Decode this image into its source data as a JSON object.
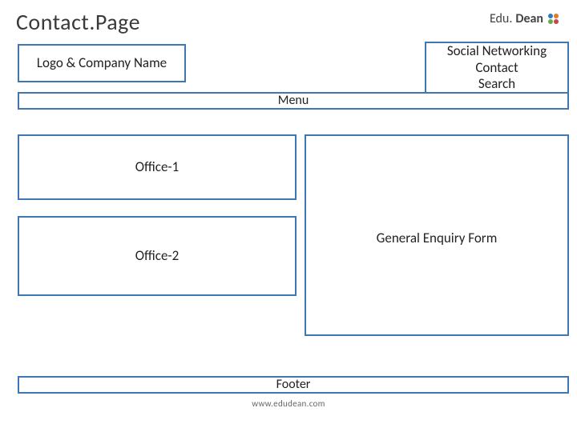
{
  "page_title": "Contact.Page",
  "brand": {
    "part1": "Edu.",
    "part2": "Dean"
  },
  "boxes": {
    "logo": "Logo & Company Name",
    "top_right": {
      "line1": "Social Networking",
      "line2": "Contact",
      "line3": "Search"
    },
    "menu": "Menu",
    "office1": "Office-1",
    "office2": "Office-2",
    "enquiry": "General Enquiry Form",
    "footer": "Footer"
  },
  "url": "www.edudean.com"
}
